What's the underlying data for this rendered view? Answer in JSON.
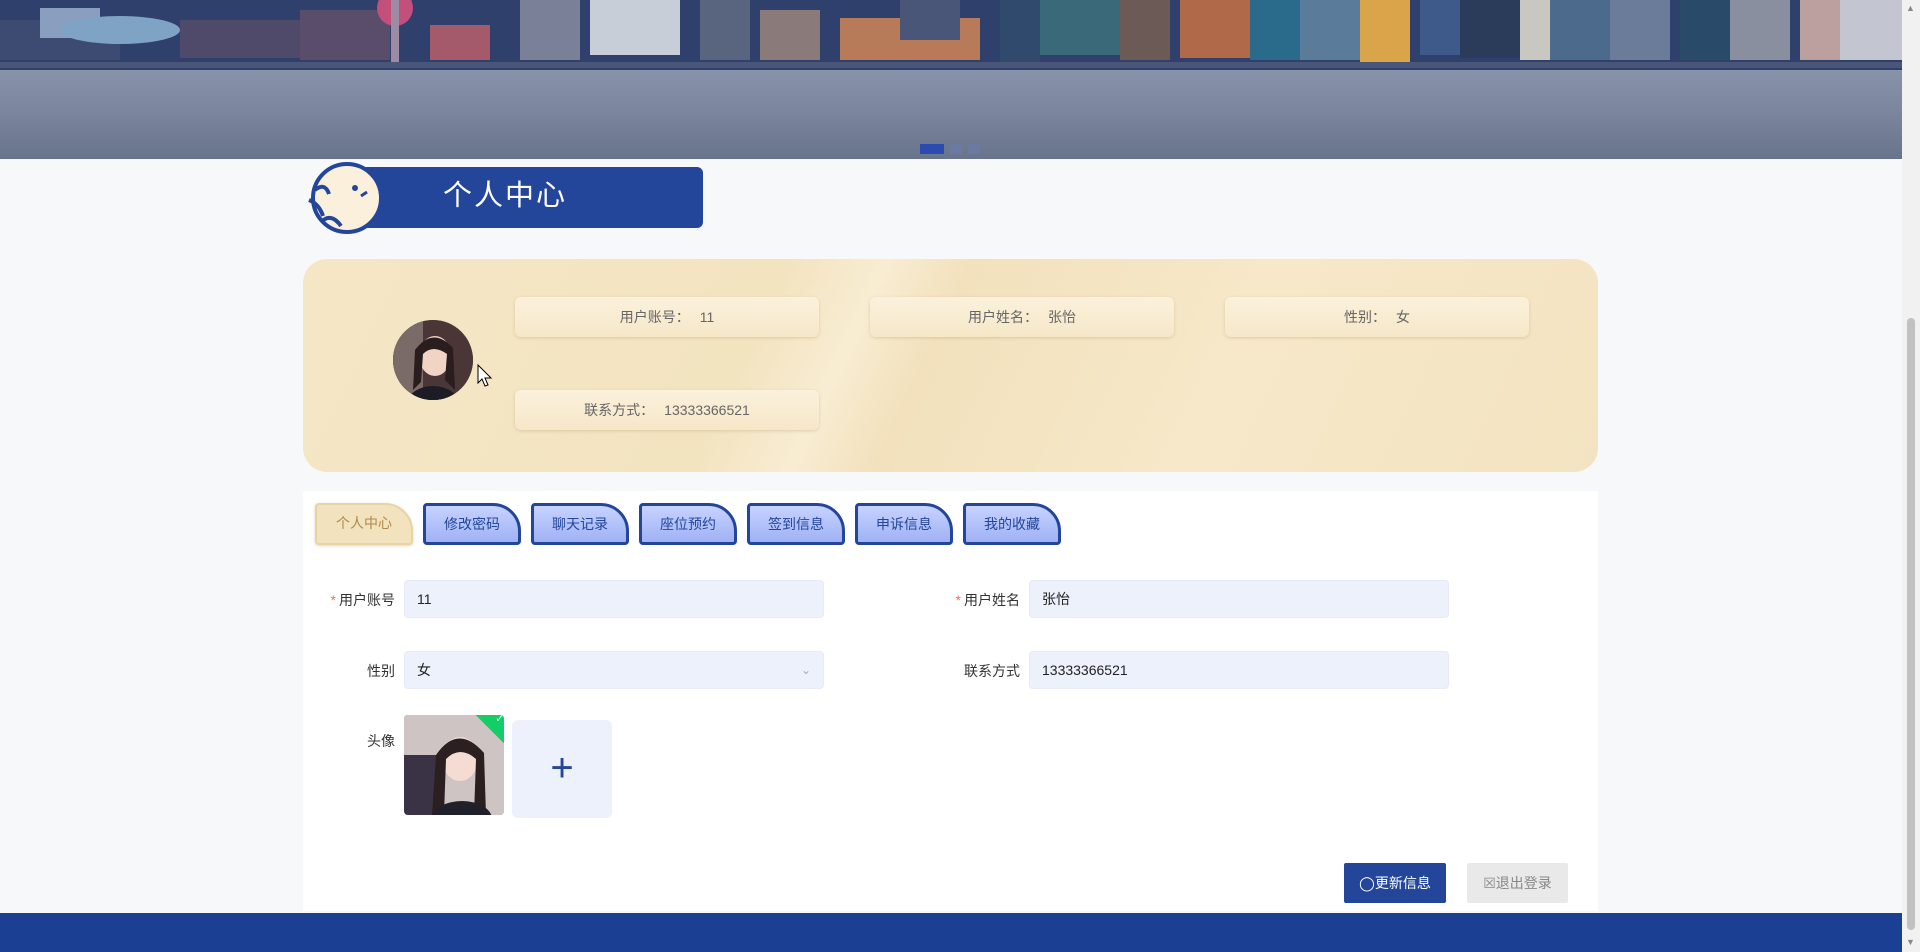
{
  "banner": {
    "slides": 3,
    "active_slide": 1
  },
  "section_title": "个人中心",
  "profile_card": {
    "account": {
      "label": "用户账号：",
      "value": "11"
    },
    "name": {
      "label": "用户姓名：",
      "value": "张怡"
    },
    "gender": {
      "label": "性别：",
      "value": "女"
    },
    "phone": {
      "label": "联系方式：",
      "value": "13333366521"
    }
  },
  "tabs": [
    "个人中心",
    "修改密码",
    "聊天记录",
    "座位预约",
    "签到信息",
    "申诉信息",
    "我的收藏"
  ],
  "form": {
    "required_mark": "*",
    "account_label": "用户账号",
    "account_value": "11",
    "name_label": "用户姓名",
    "name_value": "张怡",
    "gender_label": "性别",
    "gender_value": "女",
    "phone_label": "联系方式",
    "phone_value": "13333366521",
    "avatar_label": "头像",
    "upload_plus": "+"
  },
  "buttons": {
    "update": "更新信息",
    "logout": "退出登录"
  },
  "colors": {
    "primary": "#23469a",
    "card": "#f3e4c0",
    "footer": "#1b3f93",
    "success": "#13ce66"
  }
}
